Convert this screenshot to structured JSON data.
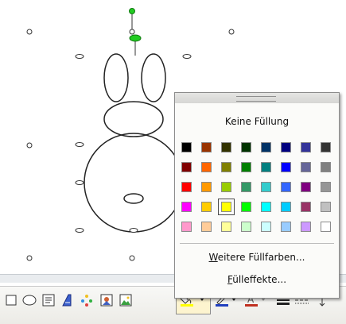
{
  "palette": {
    "no_fill_label": "Keine Füllung",
    "more_colors_label": "Weitere Füllfarben...",
    "more_colors_accel": "W",
    "more_colors_rest": "eitere Füllfarben...",
    "fill_effects_label": "Fülleffekte...",
    "fill_effects_accel": "F",
    "fill_effects_rest": "ülleffekte...",
    "selected_color": "#ffff00",
    "colors": [
      [
        "#000000",
        "#993300",
        "#333300",
        "#003300",
        "#003366",
        "#000080",
        "#333399",
        "#333333"
      ],
      [
        "#800000",
        "#ff6600",
        "#808000",
        "#008000",
        "#008080",
        "#0000ff",
        "#666699",
        "#808080"
      ],
      [
        "#ff0000",
        "#ff9900",
        "#99cc00",
        "#339966",
        "#33cccc",
        "#3366ff",
        "#800080",
        "#969696"
      ],
      [
        "#ff00ff",
        "#ffcc00",
        "#ffff00",
        "#00ff00",
        "#00ffff",
        "#00ccff",
        "#993366",
        "#c0c0c0"
      ],
      [
        "#ff99cc",
        "#ffcc99",
        "#ffff99",
        "#ccffcc",
        "#ccffff",
        "#99ccff",
        "#cc99ff",
        "#ffffff"
      ]
    ]
  },
  "toolbar": {
    "icons": [
      "rectangle-icon",
      "oval-icon",
      "textbox-icon",
      "wordart-icon",
      "diagram-icon",
      "clipart-icon",
      "picture-icon",
      "fill-color-icon",
      "line-color-icon",
      "font-color-icon",
      "line-style-icon",
      "dash-style-icon",
      "arrow-style-icon"
    ],
    "fill_color": "#ffff00",
    "line_color": "#1f3fbf",
    "font_color": "#c03020"
  }
}
